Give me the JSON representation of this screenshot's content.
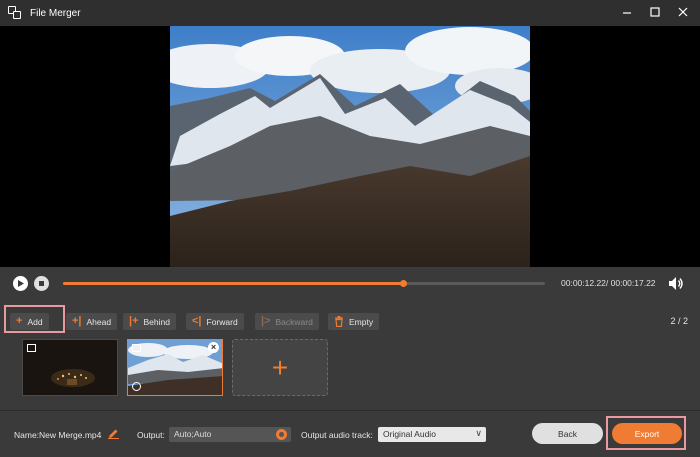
{
  "app": {
    "title": "File Merger"
  },
  "player": {
    "progress": 0.705,
    "time": "00:00:12.22/ 00:00:17.22"
  },
  "toolbar": {
    "add_label": "Add",
    "ahead_label": "Ahead",
    "behind_label": "Behind",
    "forward_label": "Forward",
    "backward_label": "Backward",
    "empty_label": "Empty",
    "page_count": "2 / 2"
  },
  "clips": {
    "add_symbol": "+"
  },
  "bottom": {
    "name_label": "Name:New Merge.mp4",
    "output_label": "Output:",
    "output_value": "Auto;Auto",
    "audio_label": "Output audio track:",
    "audio_value": "Original Audio",
    "back_label": "Back",
    "export_label": "Export"
  },
  "colors": {
    "accent": "#f07b32",
    "highlight": "#e89aa0"
  },
  "icons": [
    "app-icon",
    "minimize-icon",
    "maximize-icon",
    "close-icon",
    "play-icon",
    "stop-icon",
    "volume-icon",
    "plus-icon",
    "edit-icon",
    "gear-icon",
    "chevron-down-icon"
  ]
}
